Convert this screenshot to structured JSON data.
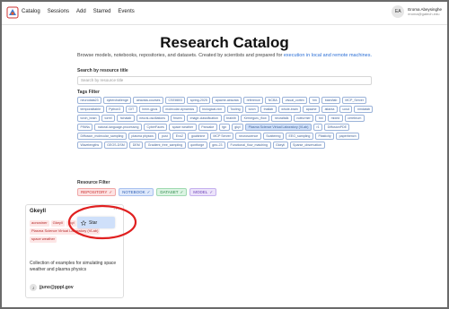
{
  "nav": {
    "links": [
      "Catalog",
      "Sessions",
      "Add",
      "Starred",
      "Events"
    ],
    "user": {
      "initials": "EA",
      "name": "Eroma Abeysinghe",
      "email": "eroma@gatech.edu"
    }
  },
  "header": {
    "title": "Research Catalog",
    "subtitle": "Browse models, notebooks, repositories, and datasets. Created by scientists and prepared for",
    "subtitle_link": "execution in local and remote machines."
  },
  "search": {
    "label": "Search by resource title",
    "placeholder": "Search by resource title"
  },
  "tags_filter": {
    "label": "Tags Filter",
    "tags": [
      {
        "name": "neurodata23"
      },
      {
        "name": "cyberchallenge"
      },
      {
        "name": "airavata-courses"
      },
      {
        "name": "CSE8803"
      },
      {
        "name": "spring-2025"
      },
      {
        "name": "apache-airavata"
      },
      {
        "name": "reference"
      },
      {
        "name": "NCBA"
      },
      {
        "name": "visual_cortex"
      },
      {
        "name": "hm"
      },
      {
        "name": "bash/lab"
      },
      {
        "name": "MCP_Server"
      },
      {
        "name": "temporalitable"
      },
      {
        "name": "Python3"
      },
      {
        "name": "GIT"
      },
      {
        "name": "hmm-gpus"
      },
      {
        "name": "molecular-dynamics"
      },
      {
        "name": "biological-nim"
      },
      {
        "name": "Tooling"
      },
      {
        "name": "torch"
      },
      {
        "name": "thallab"
      },
      {
        "name": "whole-brain"
      },
      {
        "name": "apache"
      },
      {
        "name": "atlanta"
      },
      {
        "name": "ucsd"
      },
      {
        "name": "nmdatab"
      },
      {
        "name": "torch_brain"
      },
      {
        "name": "torrel"
      },
      {
        "name": "hchalab"
      },
      {
        "name": "neural-oscillations"
      },
      {
        "name": "fmwm"
      },
      {
        "name": "image-classification"
      },
      {
        "name": "brainlit"
      },
      {
        "name": "Kerneguru_flow"
      },
      {
        "name": "neuraltalk"
      },
      {
        "name": "notfurmer"
      },
      {
        "name": "hnl"
      },
      {
        "name": "mixed"
      },
      {
        "name": "cerebrum"
      },
      {
        "name": "PINNs"
      },
      {
        "name": "natural-language-processing"
      },
      {
        "name": "CyberFaces"
      },
      {
        "name": "space weather"
      },
      {
        "name": "Pancake"
      },
      {
        "name": "fgn"
      },
      {
        "name": "gkyl"
      },
      {
        "name": "Plasma Science Virtual Laboratory (VLab)",
        "selected": true
      },
      {
        "name": "r1"
      },
      {
        "name": "DiffusionPDE"
      },
      {
        "name": "Diffusion_molecular_sampling"
      },
      {
        "name": "plasma physics"
      },
      {
        "name": "pust"
      },
      {
        "name": "Evo2"
      },
      {
        "name": "goalshine"
      },
      {
        "name": "MCP Server"
      },
      {
        "name": "neuroscience"
      },
      {
        "name": "Scattering"
      },
      {
        "name": "EEG_sampling"
      },
      {
        "name": "Plasticity"
      },
      {
        "name": "paperbench"
      },
      {
        "name": "Wavelengths"
      },
      {
        "name": "GEOS-DSM"
      },
      {
        "name": "DEM"
      },
      {
        "name": "Gradient_free_sampling"
      },
      {
        "name": "qontforge"
      },
      {
        "name": "geo-23"
      },
      {
        "name": "Functional_flow_matching"
      },
      {
        "name": "Gkeyll"
      },
      {
        "name": "Sparse_observation"
      }
    ]
  },
  "resource_filter": {
    "label": "Resource Filter",
    "items": [
      {
        "label": "REPOSITORY",
        "check": "✓"
      },
      {
        "label": "NOTEBOOK",
        "check": "✓"
      },
      {
        "label": "DATASET",
        "check": "✓"
      },
      {
        "label": "MODEL",
        "check": "✓"
      }
    ]
  },
  "card": {
    "title": "Gkeyll",
    "menu": "···",
    "tags": [
      "aoncstner",
      "Gkeyll",
      "gkyl",
      "plasma physics",
      "Plasma Science Virtual Laboratory (VLab)",
      "space weather"
    ],
    "description": "Collection of examples for simulating space weather and plasma physics",
    "owner_initial": "J",
    "owner": "jjuno@pppl.gov"
  },
  "star_popup": {
    "label": "Star",
    "icon": "star-icon"
  },
  "colors": {
    "accent": "#2b6fd6",
    "highlight_ring": "#e02020",
    "tag_border": "#9bb3d9"
  }
}
